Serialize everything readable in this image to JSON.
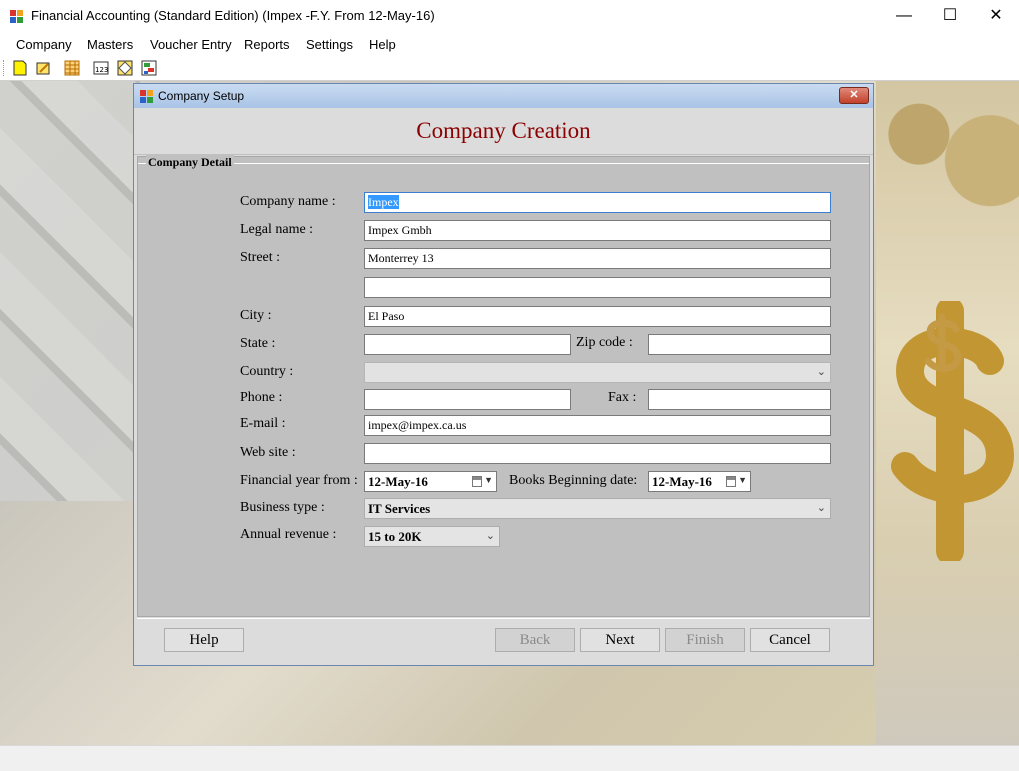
{
  "window": {
    "title": "Financial Accounting (Standard Edition) (Impex -F.Y. From 12-May-16)",
    "minimize_glyph": "—",
    "maximize_glyph": "☐",
    "close_glyph": "✕"
  },
  "menubar": {
    "items": [
      "Company",
      "Masters",
      "Voucher Entry",
      "Reports",
      "Settings",
      "Help"
    ]
  },
  "toolbar": {
    "icons": [
      "new-icon",
      "open-icon",
      "grid-icon",
      "calculator-icon",
      "diamond-icon",
      "chart-icon"
    ]
  },
  "dialog": {
    "title": "Company Setup",
    "close_glyph": "✕",
    "heading": "Company Creation",
    "group_label": "Company Detail",
    "fields": {
      "company_name": {
        "label": "Company name :",
        "value": "Impex"
      },
      "legal_name": {
        "label": "Legal name :",
        "value": "Impex Gmbh"
      },
      "street": {
        "label": "Street :",
        "value": "Monterrey 13"
      },
      "street2": {
        "value": ""
      },
      "city": {
        "label": "City :",
        "value": "El Paso"
      },
      "state": {
        "label": "State :",
        "value": ""
      },
      "zip": {
        "label": "Zip code :",
        "value": ""
      },
      "country": {
        "label": "Country :",
        "value": ""
      },
      "phone": {
        "label": "Phone :",
        "value": ""
      },
      "fax": {
        "label": "Fax :",
        "value": ""
      },
      "email": {
        "label": "E-mail :",
        "value": "impex@impex.ca.us"
      },
      "website": {
        "label": "Web site :",
        "value": ""
      },
      "fy_from": {
        "label": "Financial year from :",
        "value": "12-May-16"
      },
      "books_begin": {
        "label": "Books Beginning date:",
        "value": "12-May-16"
      },
      "business_type": {
        "label": "Business type :",
        "value": "IT Services"
      },
      "annual_revenue": {
        "label": "Annual revenue :",
        "value": "15 to 20K"
      }
    },
    "buttons": {
      "help": "Help",
      "back": "Back",
      "next": "Next",
      "finish": "Finish",
      "cancel": "Cancel"
    }
  },
  "colors": {
    "heading": "#8b0000",
    "selection": "#3399ff",
    "dialog_title_bar": "#a9c4e6"
  }
}
